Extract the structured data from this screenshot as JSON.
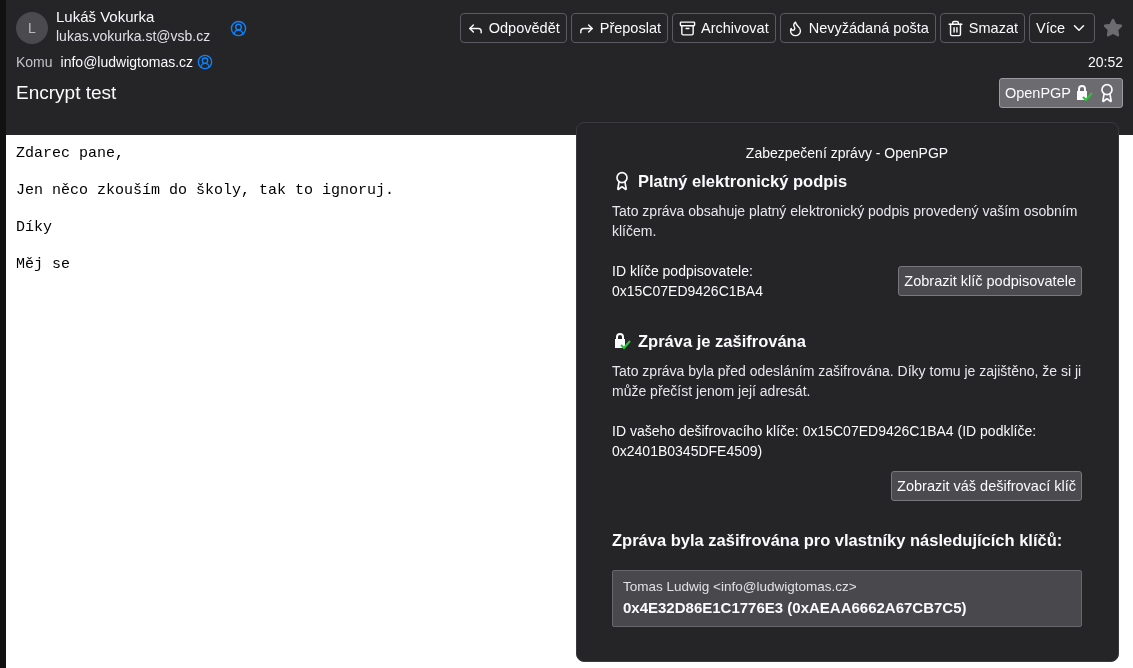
{
  "sender": {
    "avatar": "L",
    "name": "Lukáš Vokurka",
    "email": "lukas.vokurka.st@vsb.cz"
  },
  "toolbar": [
    {
      "label": "Odpovědět",
      "kind": "reply"
    },
    {
      "label": "Přeposlat",
      "kind": "forward"
    },
    {
      "label": "Archivovat",
      "kind": "archive"
    },
    {
      "label": "Nevyžádaná pošta",
      "kind": "junk"
    },
    {
      "label": "Smazat",
      "kind": "delete"
    },
    {
      "label": "Více",
      "kind": "more"
    }
  ],
  "starred": false,
  "recipient": {
    "label": "Komu",
    "email": "info@ludwigtomas.cz"
  },
  "time": "20:52",
  "subject": "Encrypt test",
  "security_button": {
    "label": "OpenPGP",
    "encrypted": true,
    "signed": true
  },
  "body": [
    "Zdarec pane,",
    "Jen něco zkouším do školy, tak to ignoruj.",
    "Díky",
    "Měj se"
  ],
  "security_panel": {
    "title": "Zabezpečení zprávy - OpenPGP",
    "sections": [
      {
        "kind": "signature",
        "heading": "Platný elektronický podpis",
        "description": "Tato zpráva obsahuje platný elektronický podpis provedený vaším osobním klíčem.",
        "key_label": "ID klíče podpisovatele:",
        "key_value": "0x15C07ED9426C1BA4",
        "button": "Zobrazit klíč podpisovatele"
      },
      {
        "kind": "encryption",
        "heading": "Zpráva je zašifrována",
        "description": "Tato zpráva byla před odesláním zašifrována. Díky tomu je zajištěno, že si ji může přečíst jenom její adresát.",
        "key_info": "ID vašeho dešifrovacího klíče: 0x15C07ED9426C1BA4 (ID podklíče: 0x2401B0345DFE4509)",
        "button": "Zobrazit váš dešifrovací klíč"
      }
    ],
    "recipients_heading": "Zpráva byla zašifrována pro vlastníky následujících klíčů:",
    "recipients": [
      {
        "name": "Tomas Ludwig <info@ludwigtomas.cz>",
        "key": "0x4E32D86E1C1776E3 (0xAEAA6662A67CB7C5)"
      }
    ]
  }
}
